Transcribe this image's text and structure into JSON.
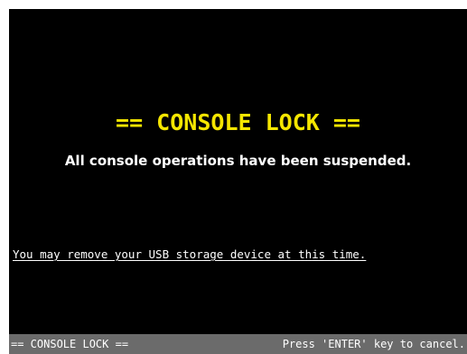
{
  "screen": {
    "title": "== CONSOLE LOCK ==",
    "message": "All console operations have been suspended.",
    "usb_notice": "You may remove your USB storage device at this time."
  },
  "status_bar": {
    "left_text": "== CONSOLE LOCK ==",
    "right_text": "Press 'ENTER' key to cancel."
  },
  "colors": {
    "background": "#000000",
    "title": "#f5e600",
    "text": "#ffffff",
    "status_bar": "#6b6b6b"
  }
}
